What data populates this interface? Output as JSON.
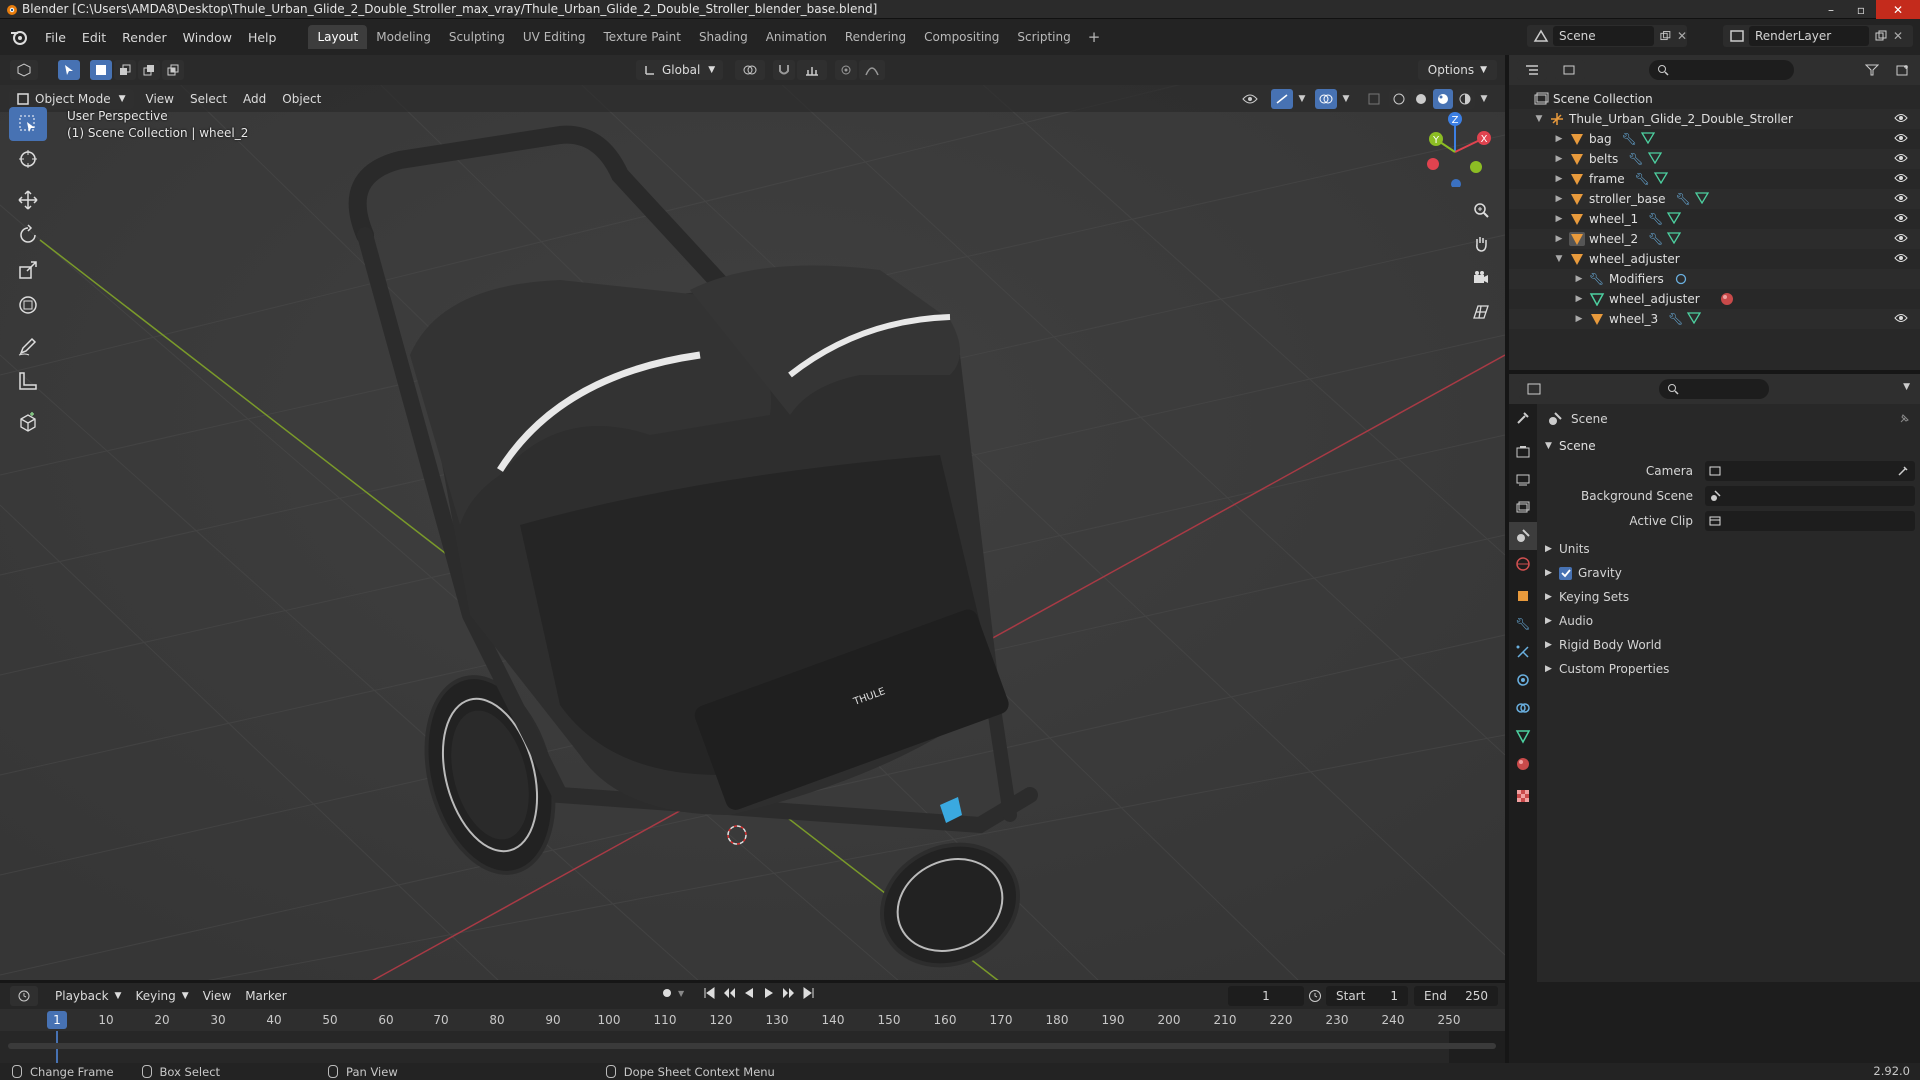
{
  "window": {
    "title": "Blender [C:\\Users\\AMDA8\\Desktop\\Thule_Urban_Glide_2_Double_Stroller_max_vray/Thule_Urban_Glide_2_Double_Stroller_blender_base.blend]",
    "minimize": "–",
    "maximize": "▫",
    "close": "✕"
  },
  "menu": [
    "File",
    "Edit",
    "Render",
    "Window",
    "Help"
  ],
  "workspaces": [
    "Layout",
    "Modeling",
    "Sculpting",
    "UV Editing",
    "Texture Paint",
    "Shading",
    "Animation",
    "Rendering",
    "Compositing",
    "Scripting"
  ],
  "workspace_add": "+",
  "scene_name": "Scene",
  "render_layer": "RenderLayer",
  "viewport": {
    "transform_orientation": "Global",
    "options_label": "Options",
    "mode": "Object Mode",
    "header_menus": [
      "View",
      "Select",
      "Add",
      "Object"
    ],
    "overlay_line1": "User Perspective",
    "overlay_line2": "(1) Scene Collection | wheel_2",
    "gizmo_axes": {
      "x": "X",
      "y": "Y",
      "z": "Z"
    },
    "colors": {
      "x_axis": "#e0434f",
      "y_axis": "#8cbd24",
      "z_axis": "#3c7fe3",
      "selected": "#4772b3"
    }
  },
  "outliner": {
    "root": "Scene Collection",
    "items": [
      {
        "label": "Thule_Urban_Glide_2_Double_Stroller"
      },
      {
        "label": "bag"
      },
      {
        "label": "belts"
      },
      {
        "label": "frame"
      },
      {
        "label": "stroller_base"
      },
      {
        "label": "wheel_1"
      },
      {
        "label": "wheel_2"
      },
      {
        "label": "wheel_adjuster"
      },
      {
        "label": "Modifiers"
      },
      {
        "label": "wheel_adjuster"
      },
      {
        "label": "wheel_3"
      }
    ]
  },
  "properties": {
    "context": "Scene",
    "panel": "Scene",
    "fields": {
      "camera_label": "Camera",
      "background_label": "Background Scene",
      "clip_label": "Active Clip"
    },
    "subpanels": {
      "units": "Units",
      "gravity": "Gravity",
      "keying_sets": "Keying Sets",
      "audio": "Audio",
      "rigid_body": "Rigid Body World",
      "custom": "Custom Properties"
    }
  },
  "timeline": {
    "menus": [
      "Playback",
      "Keying",
      "View",
      "Marker"
    ],
    "current_frame": "1",
    "start_label": "Start",
    "start_value": "1",
    "end_label": "End",
    "end_value": "250",
    "playhead": "1",
    "ticks": [
      "10",
      "20",
      "30",
      "40",
      "50",
      "60",
      "70",
      "80",
      "90",
      "100",
      "110",
      "120",
      "130",
      "140",
      "150",
      "160",
      "170",
      "180",
      "190",
      "200",
      "210",
      "220",
      "230",
      "240",
      "250"
    ]
  },
  "status": {
    "change_frame": "Change Frame",
    "box_select": "Box Select",
    "pan_view": "Pan View",
    "context_menu": "Dope Sheet Context Menu",
    "version": "2.92.0"
  }
}
